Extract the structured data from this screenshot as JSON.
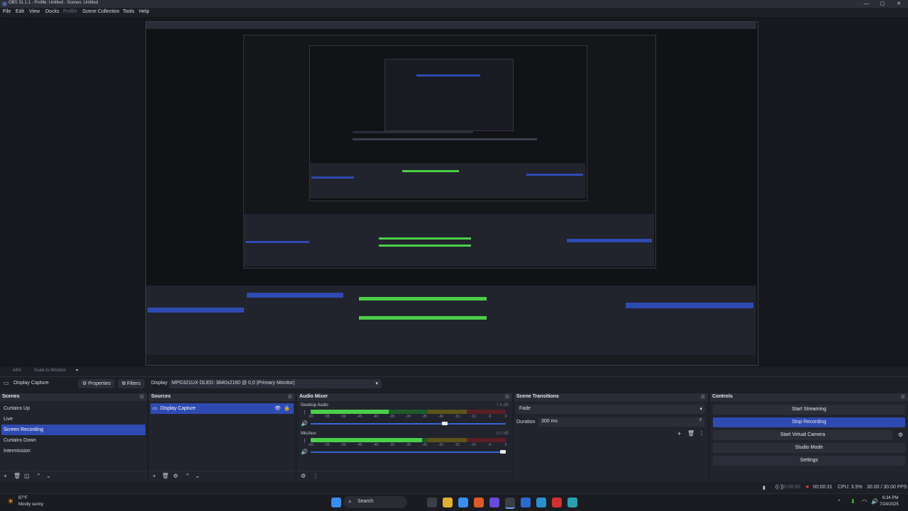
{
  "window": {
    "title": "OBS 31.1.1 - Profile: Untitled - Scenes: Untitled",
    "controls": [
      "—",
      "▢",
      "✕"
    ]
  },
  "menubar": {
    "items": [
      "File",
      "Edit",
      "View",
      "Docks",
      "Profile",
      "Scene Collection",
      "Tools",
      "Help"
    ]
  },
  "zoom": {
    "percent": "44%",
    "mode": "Scale to Window"
  },
  "toolbar": {
    "source_name": "Display Capture",
    "properties_label": "Properties",
    "filters_label": "Filters",
    "display_label": "Display",
    "display_value": "MPG321UX OLED: 3840x2160 @ 0,0 (Primary Monitor)"
  },
  "scenes": {
    "title": "Scenes",
    "items": [
      "Curtains Up",
      "Live",
      "Screen Recording",
      "Curtains Down",
      "Intermission"
    ],
    "selected_index": 2
  },
  "sources": {
    "title": "Sources",
    "items": [
      "Display Capture"
    ]
  },
  "mixer": {
    "title": "Audio Mixer",
    "channels": [
      {
        "name": "Desktop Audio",
        "db": "-7.8 dB",
        "level": 0.4,
        "volume": 0.7
      },
      {
        "name": "Mic/Aux",
        "db": "0.0 dB",
        "level": 0.57,
        "volume": 1.0
      }
    ],
    "ticks": [
      "-60",
      "-55",
      "-50",
      "-45",
      "-40",
      "-35",
      "-30",
      "-25",
      "-20",
      "-15",
      "-10",
      "-5",
      "0"
    ]
  },
  "transitions": {
    "title": "Scene Transitions",
    "type": "Fade",
    "duration_label": "Duration",
    "duration_value": "300 ms"
  },
  "controls": {
    "title": "Controls",
    "start_streaming": "Start Streaming",
    "stop_recording": "Stop Recording",
    "start_virtual_camera": "Start Virtual Camera",
    "studio_mode": "Studio Mode",
    "settings": "Settings"
  },
  "status": {
    "stream_time": "00:00:00",
    "rec_time": "00:00:31",
    "cpu": "CPU: 3.5%",
    "fps": "30.00 / 30.00 FPS"
  },
  "taskbar": {
    "weather_temp": "87°F",
    "weather_desc": "Mostly sunny",
    "search": "Search",
    "time": "6:34 PM",
    "date": "7/24/2025"
  },
  "colors": {
    "accent": "#2f4ab0",
    "panel": "#22242d",
    "background": "#1d1f26"
  }
}
